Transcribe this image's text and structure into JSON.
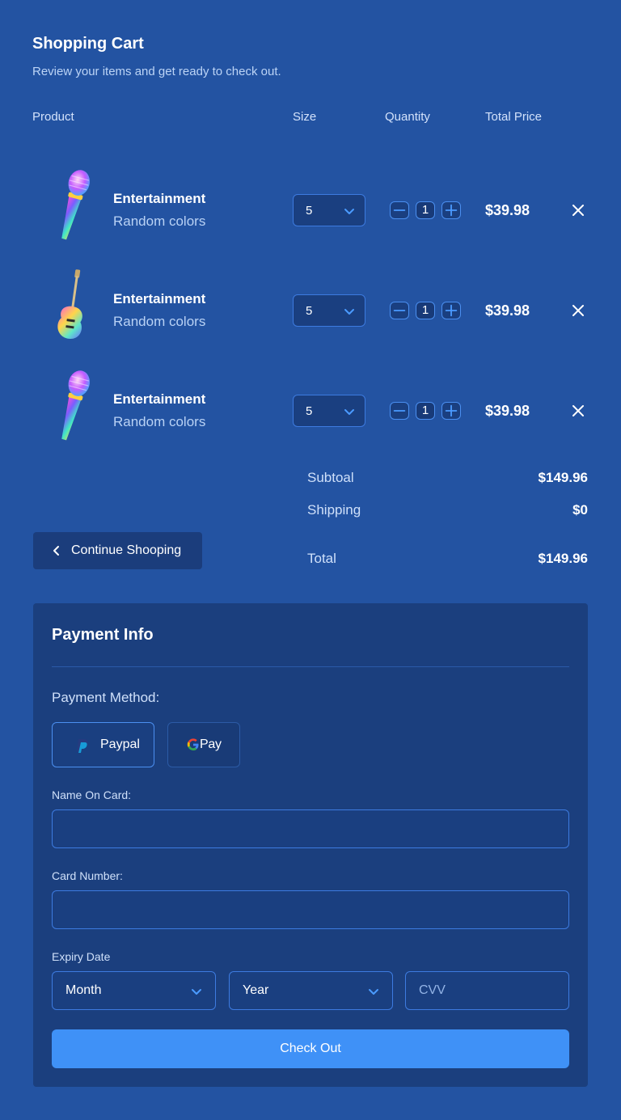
{
  "header": {
    "title": "Shopping Cart",
    "subtitle": "Review your items and get ready to check out."
  },
  "columns": {
    "product": "Product",
    "size": "Size",
    "quantity": "Quantity",
    "total_price": "Total Price"
  },
  "items": [
    {
      "image_icon": "microphone-icon",
      "name": "Entertainment",
      "variant": "Random colors",
      "size": "5",
      "quantity": "1",
      "price": "$39.98"
    },
    {
      "image_icon": "guitar-icon",
      "name": "Entertainment",
      "variant": "Random colors",
      "size": "5",
      "quantity": "1",
      "price": "$39.98"
    },
    {
      "image_icon": "microphone-icon",
      "name": "Entertainment",
      "variant": "Random colors",
      "size": "5",
      "quantity": "1",
      "price": "$39.98"
    }
  ],
  "summary": {
    "subtotal_label": "Subtoal",
    "subtotal_value": "$149.96",
    "shipping_label": "Shipping",
    "shipping_value": "$0",
    "total_label": "Total",
    "total_value": "$149.96"
  },
  "continue_button": {
    "label": "Continue Shooping",
    "icon": "chevron-left-icon"
  },
  "payment": {
    "title": "Payment Info",
    "method_label": "Payment Method:",
    "methods": [
      {
        "label": "Paypal",
        "icon": "paypal-icon",
        "selected": true
      },
      {
        "label": "Pay",
        "icon": "google-g-icon",
        "selected": false
      }
    ],
    "name_label": "Name On Card:",
    "name_value": "",
    "card_label": "Card Number:",
    "card_value": "",
    "expiry_label": "Expiry Date",
    "month_value": "Month",
    "year_value": "Year",
    "cvv_placeholder": "CVV",
    "checkout_label": "Check Out"
  },
  "colors": {
    "background": "#2353a2",
    "panel": "#1b3f7e",
    "accent": "#3f91f7",
    "input_border": "#3d7be0"
  }
}
